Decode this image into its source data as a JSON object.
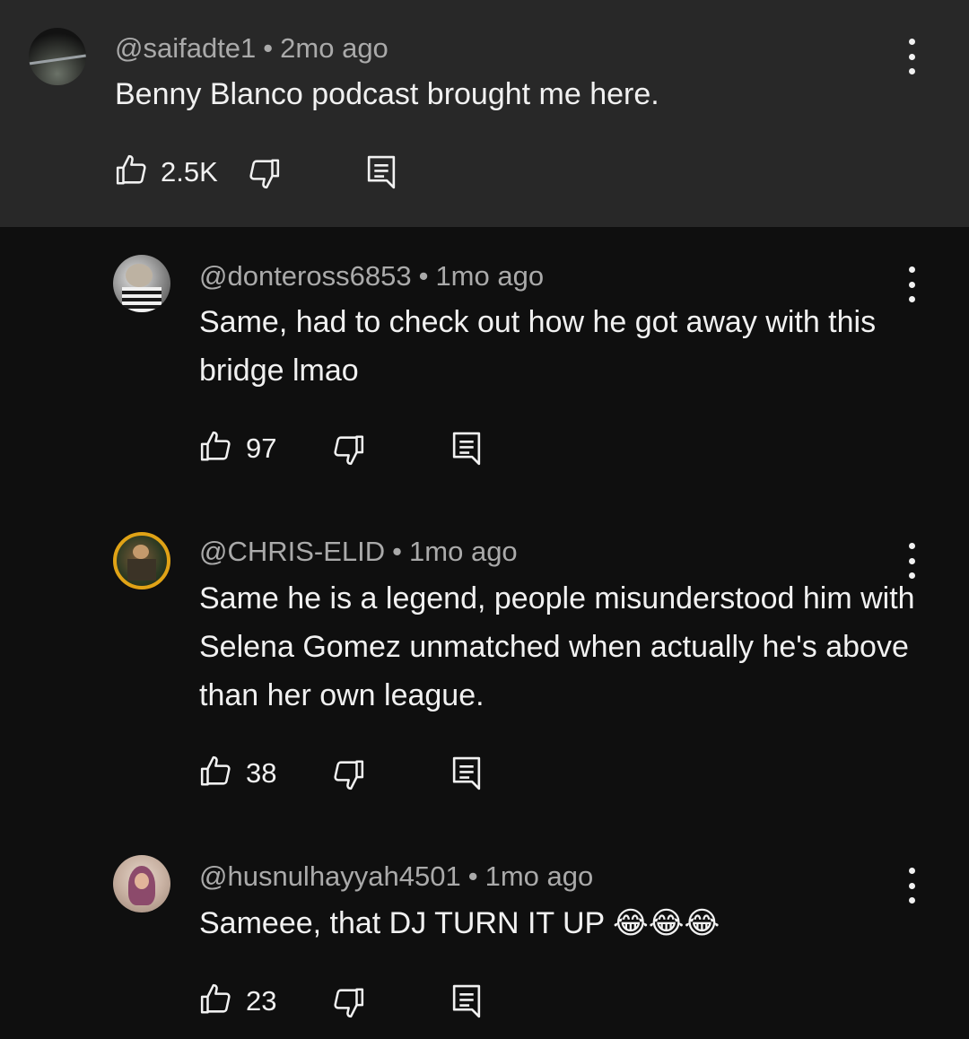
{
  "comments": [
    {
      "author": "@saifadte1",
      "time": "2mo ago",
      "separator": "•",
      "text": "Benny Blanco podcast brought me here.",
      "likes": "2.5K",
      "highlighted": true,
      "avatar_colors": [
        "#1a1a1a",
        "#5a5f55"
      ]
    },
    {
      "author": "@donteross6853",
      "time": "1mo ago",
      "separator": "•",
      "text": "Same, had to check out how he got away with this bridge lmao",
      "likes": "97",
      "avatar_colors": [
        "#c9c9c9",
        "#6c6c6c"
      ]
    },
    {
      "author": "@CHRIS-ELID",
      "time": "1mo ago",
      "separator": "•",
      "text": "Same he is a legend, people misunderstood him with Selena Gomez unmatched when actually he's above than her own league.",
      "likes": "38",
      "avatar_colors": [
        "#2c3a22",
        "#e0a316"
      ]
    },
    {
      "author": "@husnulhayyah4501",
      "time": "1mo ago",
      "separator": "•",
      "text": "Sameee, that DJ TURN IT UP 😂😂😂",
      "likes": "23",
      "avatar_colors": [
        "#d8c3b6",
        "#8c4a6b"
      ]
    }
  ],
  "icons": {
    "like": "thumbs-up-icon",
    "dislike": "thumbs-down-icon",
    "reply": "reply-comment-icon",
    "menu": "more-vertical-icon"
  },
  "colors": {
    "background": "#0f0f0f",
    "highlight_background": "#282828",
    "primary_text": "#f1f1f1",
    "secondary_text": "#aaaaaa"
  }
}
